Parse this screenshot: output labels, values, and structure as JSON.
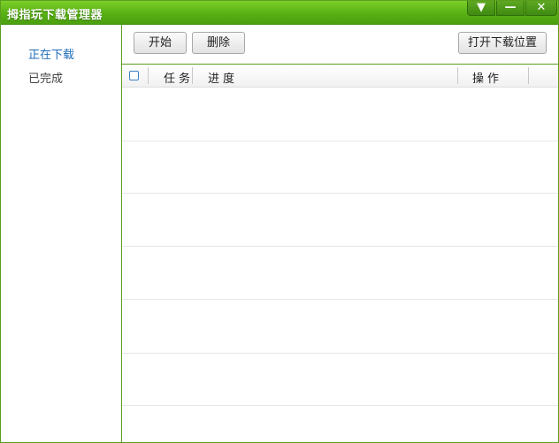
{
  "window": {
    "title": "拇指玩下载管理器",
    "controls": {
      "menu": "▼",
      "minimize": "—",
      "close": "✕"
    }
  },
  "sidebar": {
    "items": [
      {
        "label": "正在下载",
        "active": true
      },
      {
        "label": "已完成",
        "active": false
      }
    ]
  },
  "toolbar": {
    "start_label": "开始",
    "delete_label": "删除",
    "open_folder_label": "打开下载位置"
  },
  "table": {
    "columns": {
      "task": "任务",
      "progress": "进度",
      "action": "操作"
    },
    "rows": []
  },
  "colors": {
    "accent_green": "#58b014",
    "active_link": "#1f6db8",
    "checkbox_border": "#3b7fc4"
  }
}
